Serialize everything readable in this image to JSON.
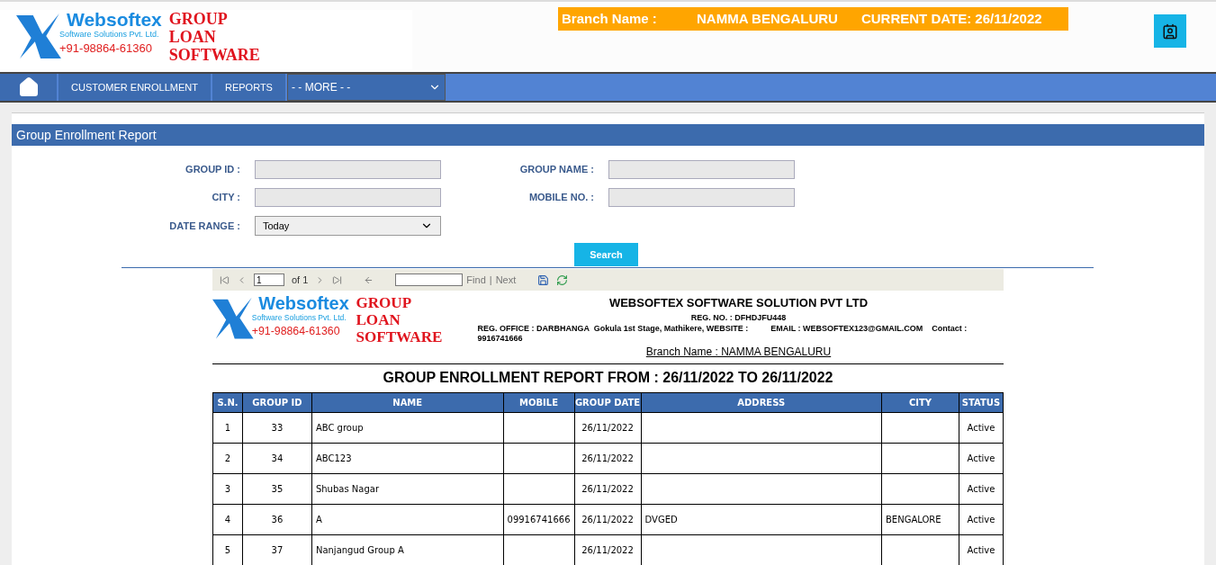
{
  "header": {
    "logo": {
      "brand": "Websoftex",
      "tagline": "Software Solutions Pvt. Ltd.",
      "phone": "+91-98864-61360",
      "product": [
        "GROUP",
        "LOAN",
        "SOFTWARE"
      ]
    },
    "branch_label": "Branch Name :",
    "branch": "NAMMA BENGALURU",
    "current_date": "CURRENT DATE: 26/11/2022"
  },
  "nav": {
    "items": [
      {
        "label": "CUSTOMER ENROLLMENT"
      },
      {
        "label": "REPORTS"
      }
    ],
    "more": "- - MORE - -"
  },
  "panel": {
    "title": "Group Enrollment Report",
    "fields": [
      {
        "label": "GROUP ID :",
        "kind": "text"
      },
      {
        "label": "GROUP NAME :",
        "kind": "text"
      },
      {
        "label": "CITY :",
        "kind": "text"
      },
      {
        "label": "MOBILE NO. :",
        "kind": "text"
      },
      {
        "label": "DATE RANGE :",
        "kind": "select",
        "value": "Today"
      }
    ],
    "search_button": "Search"
  },
  "viewer": {
    "page": "1",
    "of": "of 1",
    "find": "Find",
    "separator": "|",
    "next": "Next"
  },
  "report": {
    "logo": {
      "brand": "Websoftex",
      "tagline": "Software Solutions Pvt. Ltd.",
      "phone": "+91-98864-61360",
      "product": [
        "GROUP",
        "LOAN",
        "SOFTWARE"
      ]
    },
    "company": "WEBSOFTEX SOFTWARE SOLUTION PVT LTD",
    "reg_no": "REG. NO. : DFHDJFU448",
    "address": "REG. OFFICE : DARBHANGA  Gokula 1st Stage, Mathikere, WEBSITE :          EMAIL : WEBSOFTEX123@GMAIL.COM    Contact : 9916741666",
    "branch": "Branch Name : NAMMA BENGALURU",
    "title": "GROUP ENROLLMENT REPORT FROM : 26/11/2022 TO 26/11/2022",
    "columns": [
      "S.N.",
      "GROUP ID",
      "NAME",
      "MOBILE",
      "GROUP DATE",
      "ADDRESS",
      "CITY",
      "STATUS"
    ],
    "rows": [
      [
        "1",
        "33",
        "ABC group",
        "",
        "26/11/2022",
        "",
        "",
        "Active"
      ],
      [
        "2",
        "34",
        "ABC123",
        "",
        "26/11/2022",
        "",
        "",
        "Active"
      ],
      [
        "3",
        "35",
        "Shubas Nagar",
        "",
        "26/11/2022",
        "",
        "",
        "Active"
      ],
      [
        "4",
        "36",
        "A",
        "09916741666",
        "26/11/2022",
        "DVGED",
        "BENGALORE",
        "Active"
      ],
      [
        "5",
        "37",
        "Nanjangud Group A",
        "",
        "26/11/2022",
        "",
        "",
        "Active"
      ]
    ]
  }
}
